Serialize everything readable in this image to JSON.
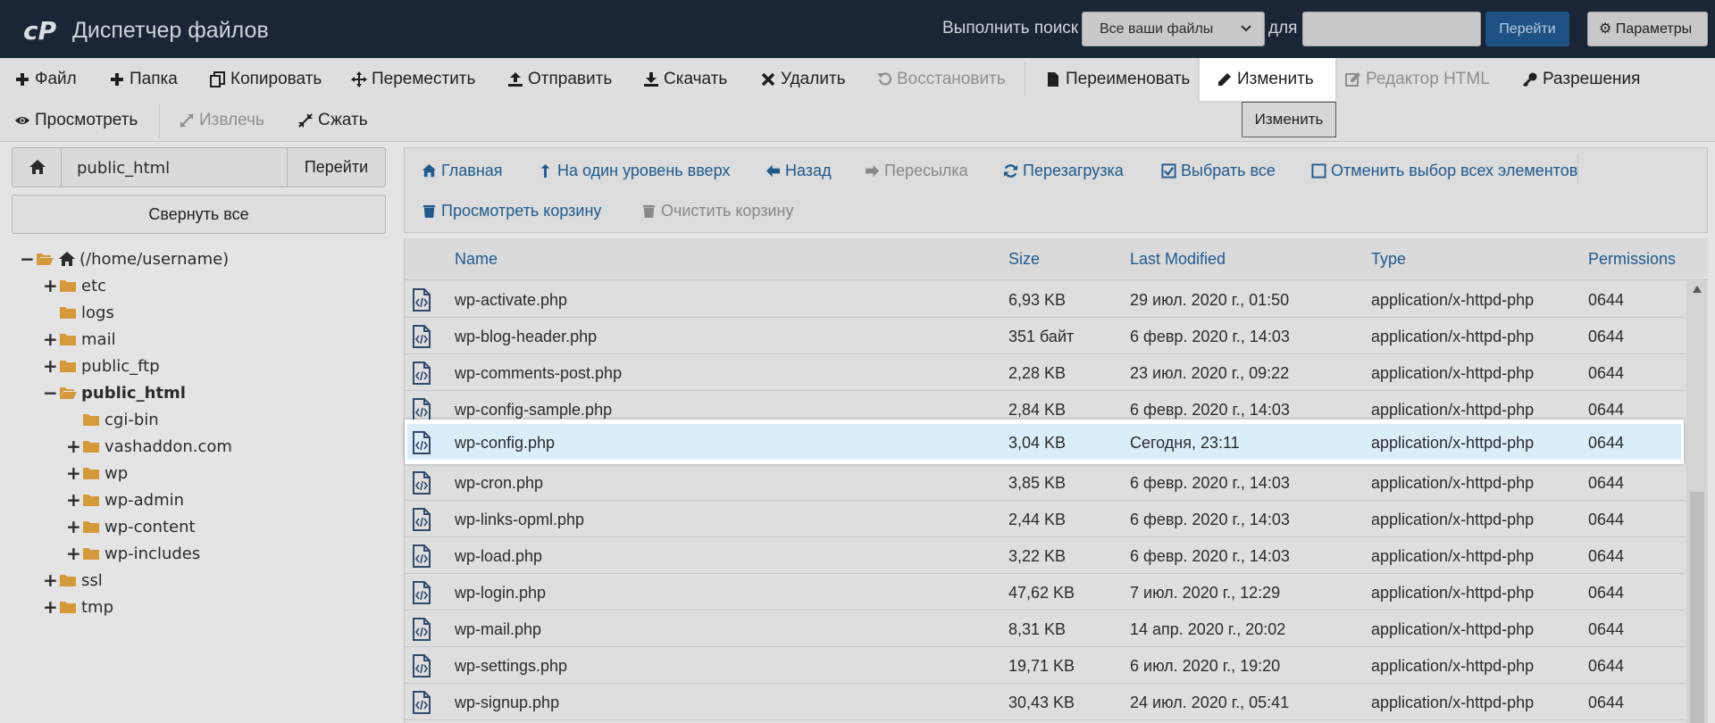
{
  "topbar": {
    "app_title": "Диспетчер файлов",
    "search_label": "Выполнить поиск",
    "search_scope": "Все ваши файлы",
    "for_label": "для",
    "search_value": "",
    "go_label": "Перейти",
    "settings_label": "Параметры"
  },
  "toolbar": {
    "file": "Файл",
    "folder": "Папка",
    "copy": "Копировать",
    "move": "Переместить",
    "upload": "Отправить",
    "download": "Скачать",
    "delete": "Удалить",
    "restore": "Восстановить",
    "rename": "Переименовать",
    "edit": "Изменить",
    "html_editor": "Редактор HTML",
    "permissions": "Разрешения",
    "view": "Просмотреть",
    "extract": "Извлечь",
    "compress": "Сжать",
    "tooltip": "Изменить"
  },
  "left": {
    "path_value": "public_html",
    "path_go": "Перейти",
    "collapse_all": "Свернуть все",
    "tree": [
      {
        "label": "(/home/username)",
        "toggle": "−"
      },
      {
        "label": "etc",
        "toggle": "+"
      },
      {
        "label": "logs",
        "toggle": ""
      },
      {
        "label": "mail",
        "toggle": "+"
      },
      {
        "label": "public_ftp",
        "toggle": "+"
      },
      {
        "label": "public_html",
        "toggle": "−"
      },
      {
        "label": "cgi-bin",
        "toggle": ""
      },
      {
        "label": "vashaddon.com",
        "toggle": "+"
      },
      {
        "label": "wp",
        "toggle": "+"
      },
      {
        "label": "wp-admin",
        "toggle": "+"
      },
      {
        "label": "wp-content",
        "toggle": "+"
      },
      {
        "label": "wp-includes",
        "toggle": "+"
      },
      {
        "label": "ssl",
        "toggle": "+"
      },
      {
        "label": "tmp",
        "toggle": "+"
      }
    ]
  },
  "nav": {
    "home": "Главная",
    "up": "На один уровень вверх",
    "back": "Назад",
    "forward": "Пересылка",
    "reload": "Перезагрузка",
    "select_all": "Выбрать все",
    "unselect_all": "Отменить выбор всех элементов",
    "view_trash": "Просмотреть корзину",
    "empty_trash": "Очистить корзину"
  },
  "table": {
    "headers": {
      "name": "Name",
      "size": "Size",
      "modified": "Last Modified",
      "type": "Type",
      "perms": "Permissions"
    },
    "rows": [
      {
        "name": "wp-activate.php",
        "size": "6,93 KB",
        "modified": "29 июл. 2020 г., 01:50",
        "type": "application/x-httpd-php",
        "perms": "0644"
      },
      {
        "name": "wp-blog-header.php",
        "size": "351 байт",
        "modified": "6 февр. 2020 г., 14:03",
        "type": "application/x-httpd-php",
        "perms": "0644"
      },
      {
        "name": "wp-comments-post.php",
        "size": "2,28 KB",
        "modified": "23 июл. 2020 г., 09:22",
        "type": "application/x-httpd-php",
        "perms": "0644"
      },
      {
        "name": "wp-config-sample.php",
        "size": "2,84 KB",
        "modified": "6 февр. 2020 г., 14:03",
        "type": "application/x-httpd-php",
        "perms": "0644"
      },
      {
        "name": "wp-config.php",
        "size": "3,04 KB",
        "modified": "Сегодня, 23:11",
        "type": "application/x-httpd-php",
        "perms": "0644"
      },
      {
        "name": "wp-cron.php",
        "size": "3,85 KB",
        "modified": "6 февр. 2020 г., 14:03",
        "type": "application/x-httpd-php",
        "perms": "0644"
      },
      {
        "name": "wp-links-opml.php",
        "size": "2,44 KB",
        "modified": "6 февр. 2020 г., 14:03",
        "type": "application/x-httpd-php",
        "perms": "0644"
      },
      {
        "name": "wp-load.php",
        "size": "3,22 KB",
        "modified": "6 февр. 2020 г., 14:03",
        "type": "application/x-httpd-php",
        "perms": "0644"
      },
      {
        "name": "wp-login.php",
        "size": "47,62 KB",
        "modified": "7 июл. 2020 г., 12:29",
        "type": "application/x-httpd-php",
        "perms": "0644"
      },
      {
        "name": "wp-mail.php",
        "size": "8,31 KB",
        "modified": "14 апр. 2020 г., 20:02",
        "type": "application/x-httpd-php",
        "perms": "0644"
      },
      {
        "name": "wp-settings.php",
        "size": "19,71 KB",
        "modified": "6 июл. 2020 г., 19:20",
        "type": "application/x-httpd-php",
        "perms": "0644"
      },
      {
        "name": "wp-signup.php",
        "size": "30,43 KB",
        "modified": "24 июл. 2020 г., 05:41",
        "type": "application/x-httpd-php",
        "perms": "0644"
      }
    ]
  },
  "colors": {
    "accent": "#1f5a8f",
    "topbar": "#1a2636",
    "folder": "#d49a3a",
    "selected_row": "#daeefa"
  }
}
